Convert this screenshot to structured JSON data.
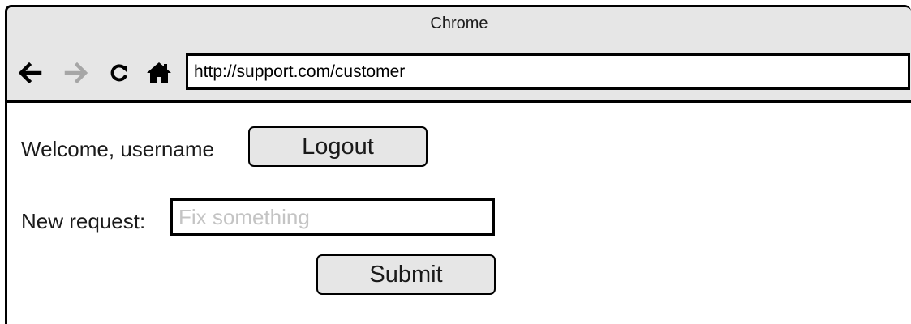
{
  "browser": {
    "title": "Chrome",
    "address": "http://support.com/customer",
    "nav": {
      "back_icon": "arrow-left-icon",
      "forward_icon": "arrow-right-icon",
      "reload_icon": "reload-icon",
      "home_icon": "home-icon"
    },
    "colors": {
      "chrome_bg": "#e6e6e6",
      "forward_disabled": "#a6a6a6",
      "border": "#000000"
    }
  },
  "page": {
    "welcome_text": "Welcome, username",
    "logout_label": "Logout",
    "new_request_label": "New request:",
    "request_placeholder": "Fix something",
    "request_value": "",
    "submit_label": "Submit",
    "colors": {
      "button_bg": "#e6e6e6",
      "placeholder": "#c4c4c4"
    }
  }
}
